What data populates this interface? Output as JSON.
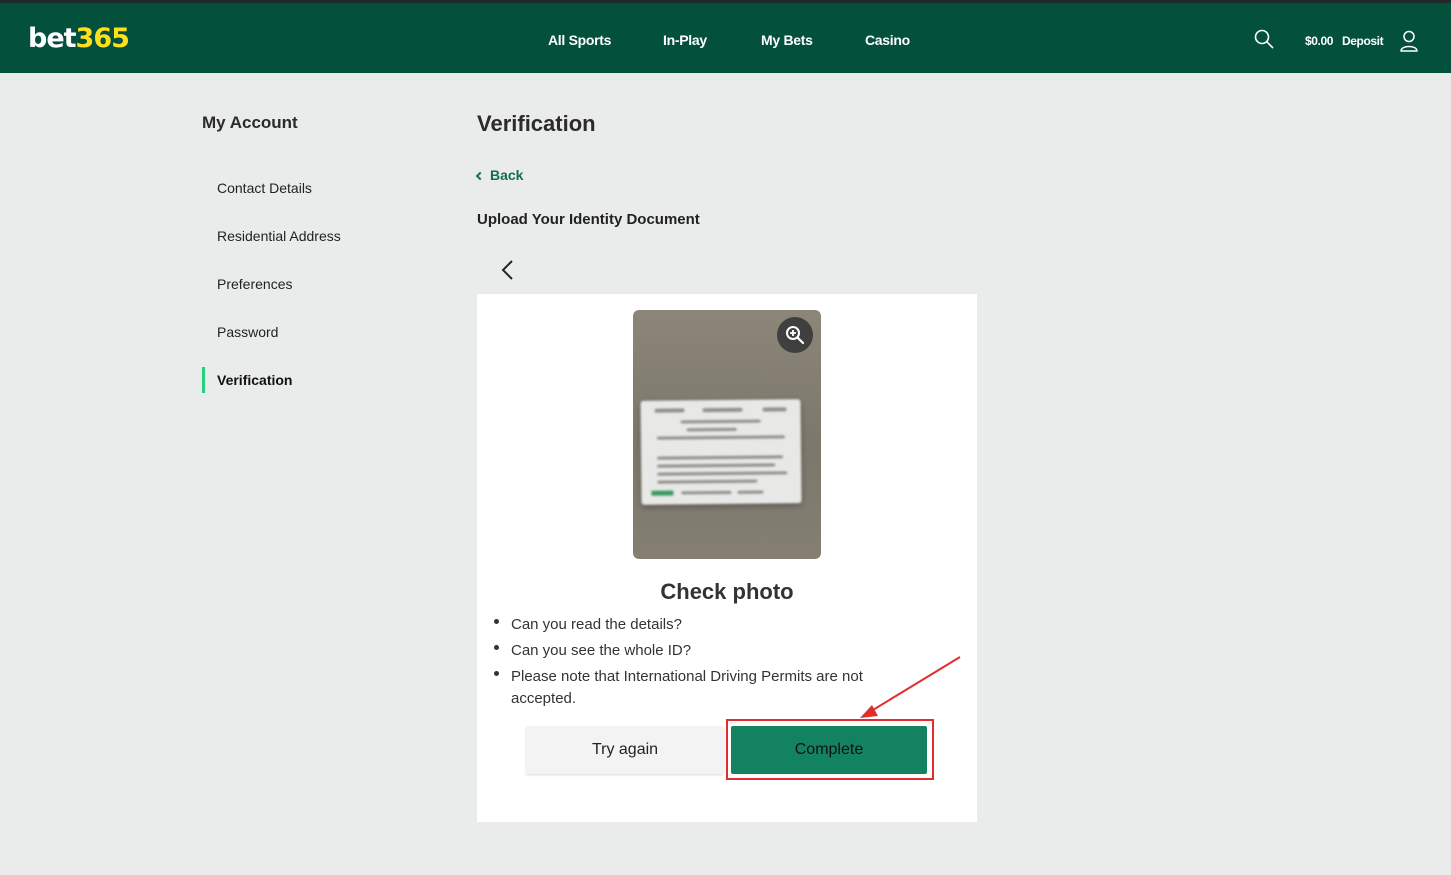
{
  "header": {
    "logo_main": "bet",
    "logo_num": "365",
    "nav": [
      "All Sports",
      "In-Play",
      "My Bets",
      "Casino"
    ],
    "balance": "$0.00",
    "deposit": "Deposit",
    "icons": {
      "search": "search-icon",
      "user": "user-icon"
    },
    "colors": {
      "bg": "#03513d",
      "logo_accent": "#ffdf1b"
    }
  },
  "sidebar": {
    "title": "My Account",
    "items": [
      {
        "label": "Contact Details",
        "active": false
      },
      {
        "label": "Residential Address",
        "active": false
      },
      {
        "label": "Preferences",
        "active": false
      },
      {
        "label": "Password",
        "active": false
      },
      {
        "label": "Verification",
        "active": true
      }
    ],
    "accent": "#25d17e"
  },
  "main": {
    "title": "Verification",
    "back_label": "Back",
    "upload_title": "Upload Your Identity Document",
    "check_title": "Check photo",
    "checklist": [
      "Can you read the details?",
      "Can you see the whole ID?",
      "Please note that International Driving Permits are not accepted."
    ],
    "try_again": "Try again",
    "complete": "Complete",
    "colors": {
      "link": "#126e51",
      "primary_button": "#138260",
      "annotation": "#e02e2e"
    }
  }
}
